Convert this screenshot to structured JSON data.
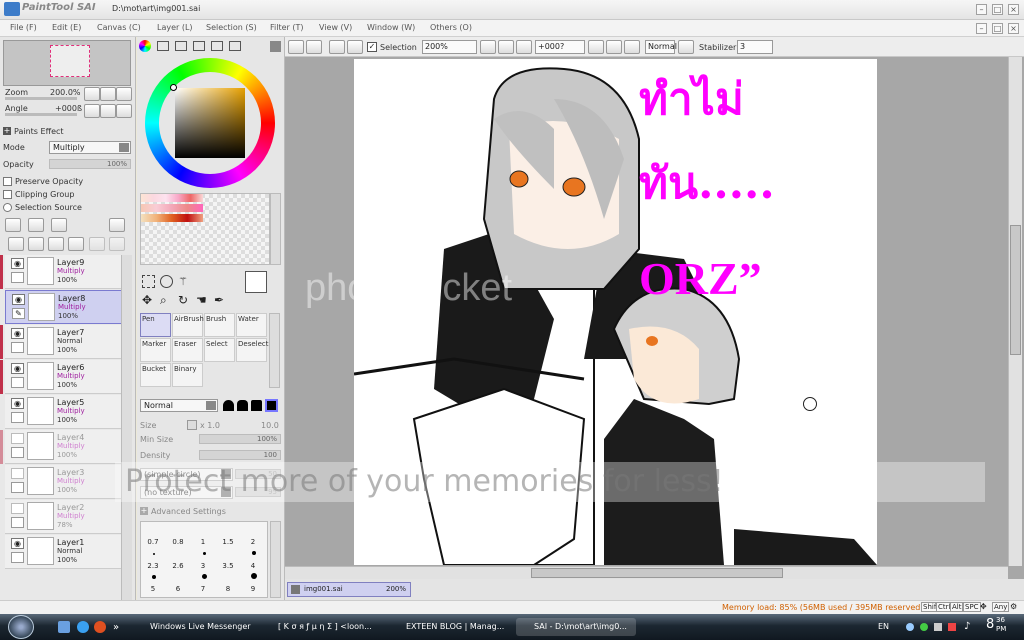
{
  "app": {
    "logo": "PaintTool SAI",
    "title": "D:\\mot\\art\\img001.sai"
  },
  "menu": [
    "File (F)",
    "Edit (E)",
    "Canvas (C)",
    "Layer (L)",
    "Selection (S)",
    "Filter (T)",
    "View (V)",
    "Window (W)",
    "Others (O)"
  ],
  "navigator": {
    "zoom_label": "Zoom",
    "zoom_value": "200.0%",
    "angle_label": "Angle",
    "angle_value": "+000ß"
  },
  "paints_effect": {
    "title": "Paints Effect",
    "mode_label": "Mode",
    "mode_value": "Multiply",
    "opacity_label": "Opacity",
    "opacity_value": "100%",
    "preserve_opacity": "Preserve Opacity",
    "clipping_group": "Clipping Group",
    "selection_source": "Selection Source"
  },
  "layers": [
    {
      "name": "Layer9",
      "mode": "Multiply",
      "opacity": "100%"
    },
    {
      "name": "Layer8",
      "mode": "Multiply",
      "opacity": "100%"
    },
    {
      "name": "Layer7",
      "mode": "Normal",
      "opacity": "100%"
    },
    {
      "name": "Layer6",
      "mode": "Multiply",
      "opacity": "100%"
    },
    {
      "name": "Layer5",
      "mode": "Multiply",
      "opacity": "100%"
    },
    {
      "name": "Layer4",
      "mode": "Multiply",
      "opacity": "100%"
    },
    {
      "name": "Layer3",
      "mode": "Multiply",
      "opacity": "100%"
    },
    {
      "name": "Layer2",
      "mode": "Multiply",
      "opacity": "78%"
    },
    {
      "name": "Layer1",
      "mode": "Normal",
      "opacity": "100%"
    }
  ],
  "tools": {
    "row1": [
      "Pen",
      "AirBrush",
      "Brush",
      "Water"
    ],
    "row2": [
      "Marker",
      "Eraser",
      "Select",
      "Deselect"
    ],
    "row3": [
      "Bucket",
      "Binary"
    ]
  },
  "brush": {
    "blend_mode": "Normal",
    "size_label": "Size",
    "size_mult": "x 1.0",
    "size_value": "10.0",
    "min_size_label": "Min Size",
    "min_size_value": "100%",
    "density_label": "Density",
    "density_value": "100",
    "shape": "(simple circle)",
    "shape_value": "50",
    "texture": "(no texture)",
    "texture_value": "95",
    "advanced": "Advanced Settings",
    "presets": [
      "0.7",
      "0.8",
      "1",
      "1.5",
      "2",
      "2.3",
      "2.6",
      "3",
      "3.5",
      "4",
      "5",
      "6",
      "7",
      "8",
      "9"
    ]
  },
  "toolbar": {
    "selection_label": "Selection",
    "zoom": "200%",
    "rotation": "+000?",
    "blend": "Normal",
    "stabilizer_label": "Stabilizer",
    "stabilizer_value": "3"
  },
  "canvas_text": {
    "line1": "ทำไม่",
    "line2": "ทัน.....",
    "line3": "ORZ”"
  },
  "watermark": {
    "brand": "photobucket",
    "tagline": "Protect more of your memories for less!"
  },
  "doc_tab": {
    "name": "img001.sai",
    "zoom": "200%"
  },
  "status": {
    "memory": "Memory load: 85% (56MB used / 395MB reserved)",
    "keys": [
      "Shift",
      "Ctrl",
      "Alt",
      "SPC",
      "Any"
    ]
  },
  "taskbar": {
    "tasks": [
      "Windows Live Messenger",
      "[ K σ я ƒ μ η Σ ] <loon...",
      "EXTEEN BLOG | Manag...",
      "SAI - D:\\mot\\art\\img0..."
    ],
    "lang": "EN",
    "clock_hour": "8",
    "clock_min": "36",
    "clock_ampm": "PM"
  },
  "colors": {
    "accent": "#ff00ff",
    "selection": "#cfd0f0",
    "layer_mark": "#c0304a"
  }
}
